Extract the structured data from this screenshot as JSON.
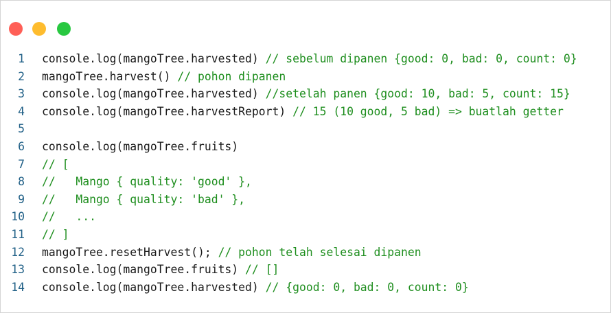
{
  "window": {
    "controls": {
      "close_color": "#ff5f57",
      "minimize_color": "#febc2e",
      "zoom_color": "#28c840"
    }
  },
  "colors": {
    "line_number": "#1f5f86",
    "code_text": "#1a1a1a",
    "comment": "#1e8e1e"
  },
  "code": {
    "lines": [
      {
        "num": "1",
        "code": "console.log(mangoTree.harvested) ",
        "comment": "// sebelum dipanen {good: 0, bad: 0, count: 0}"
      },
      {
        "num": "2",
        "code": "mangoTree.harvest() ",
        "comment": "// pohon dipanen"
      },
      {
        "num": "3",
        "code": "console.log(mangoTree.harvested) ",
        "comment": "//setelah panen {good: 10, bad: 5, count: 15}"
      },
      {
        "num": "4",
        "code": "console.log(mangoTree.harvestReport) ",
        "comment": "// 15 (10 good, 5 bad) => buatlah getter"
      },
      {
        "num": "5",
        "code": "",
        "comment": ""
      },
      {
        "num": "6",
        "code": "console.log(mangoTree.fruits)",
        "comment": ""
      },
      {
        "num": "7",
        "code": "",
        "comment": "// ["
      },
      {
        "num": "8",
        "code": "",
        "comment": "//   Mango { quality: 'good' },"
      },
      {
        "num": "9",
        "code": "",
        "comment": "//   Mango { quality: 'bad' },"
      },
      {
        "num": "10",
        "code": "",
        "comment": "//   ..."
      },
      {
        "num": "11",
        "code": "",
        "comment": "// ]"
      },
      {
        "num": "12",
        "code": "mangoTree.resetHarvest(); ",
        "comment": "// pohon telah selesai dipanen"
      },
      {
        "num": "13",
        "code": "console.log(mangoTree.fruits) ",
        "comment": "// []"
      },
      {
        "num": "14",
        "code": "console.log(mangoTree.harvested) ",
        "comment": "// {good: 0, bad: 0, count: 0}"
      }
    ]
  }
}
